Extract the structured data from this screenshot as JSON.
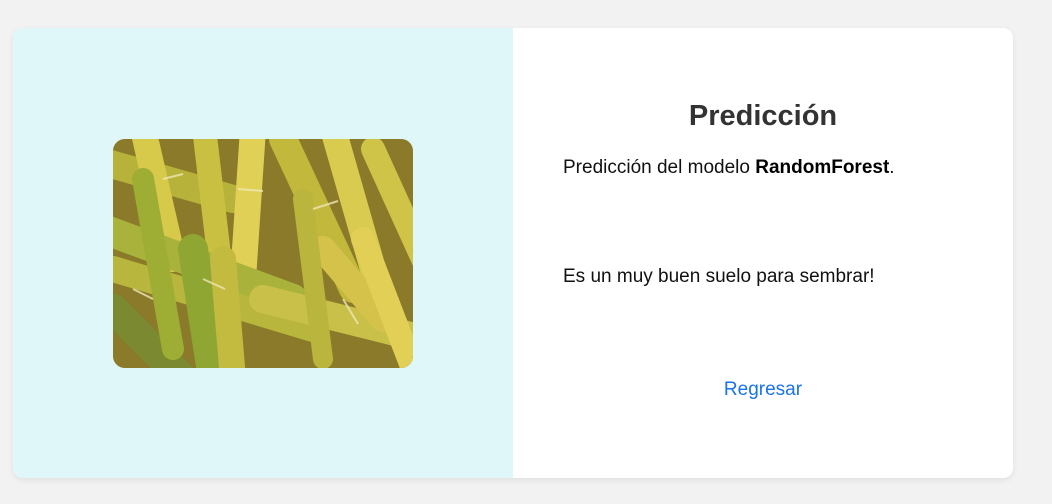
{
  "prediction": {
    "title": "Predicción",
    "model_prefix": "Predicción del modelo ",
    "model_name": "RandomForest",
    "model_suffix": ".",
    "result_text": "Es un muy buen suelo para sembrar!",
    "back_label": "Regresar"
  },
  "image": {
    "subject": "sugarcane-stalks-photo"
  },
  "colors": {
    "page_background": "#f2f2f2",
    "left_panel_background": "#e0f7fa",
    "card_background": "#ffffff",
    "title_color": "#333333",
    "link_color": "#1a73e8"
  }
}
